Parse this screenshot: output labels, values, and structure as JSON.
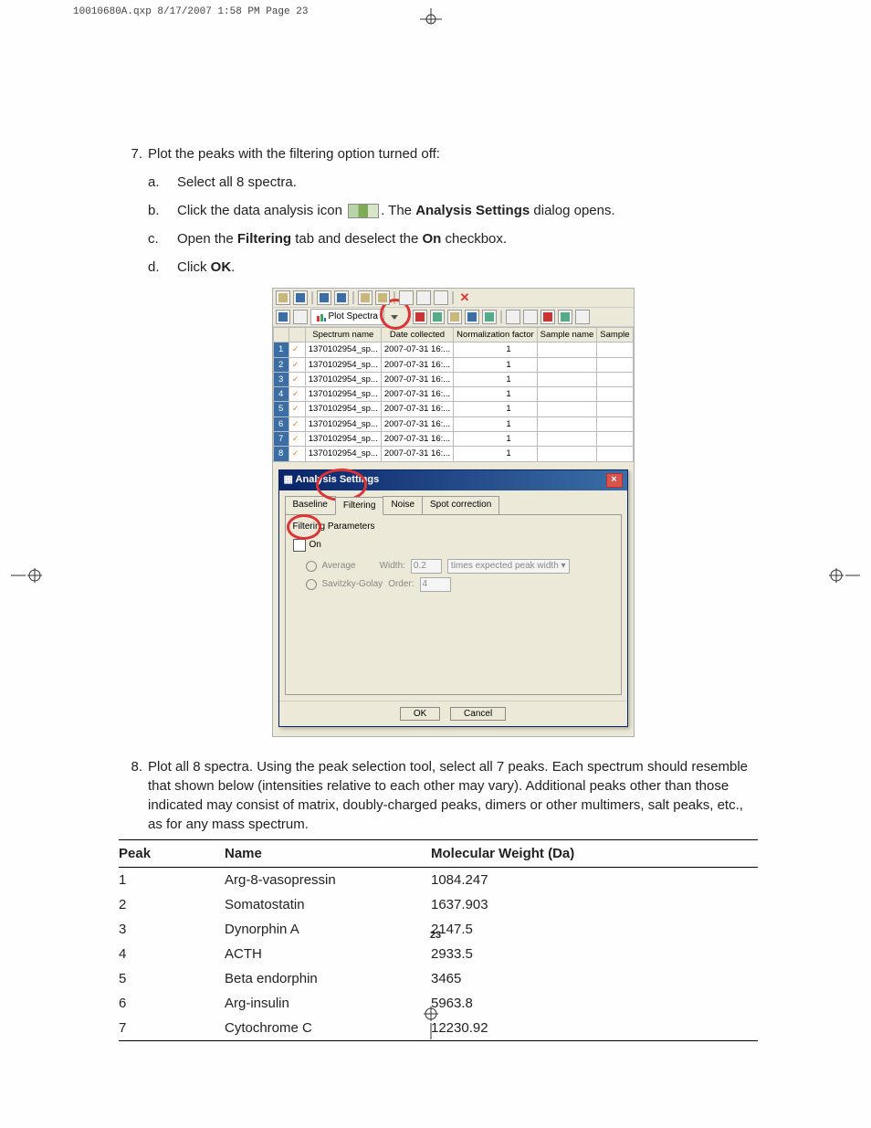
{
  "meta_header": "10010680A.qxp  8/17/2007  1:58 PM  Page 23",
  "page_number": "23",
  "step7": {
    "num": "7.",
    "intro": "Plot the peaks with the filtering option turned off:",
    "a": {
      "l": "a.",
      "t": "Select all 8 spectra."
    },
    "b": {
      "l": "b.",
      "pre": "Click the data analysis icon ",
      "post": ". The ",
      "bold": "Analysis Settings",
      "tail": " dialog opens."
    },
    "c": {
      "l": "c.",
      "pre": "Open the ",
      "b1": "Filtering",
      "mid": " tab and deselect the ",
      "b2": "On",
      "tail": " checkbox."
    },
    "d": {
      "l": "d.",
      "pre": "Click ",
      "b": "OK",
      "tail": "."
    }
  },
  "app": {
    "plot_label": "Plot Spectra",
    "columns": [
      "Spectrum name",
      "Date collected",
      "Normalization factor",
      "Sample name",
      "Sample"
    ],
    "rows": [
      {
        "n": "1",
        "name": "1370102954_sp...",
        "date": "2007-07-31 16:...",
        "nf": "1"
      },
      {
        "n": "2",
        "name": "1370102954_sp...",
        "date": "2007-07-31 16:...",
        "nf": "1"
      },
      {
        "n": "3",
        "name": "1370102954_sp...",
        "date": "2007-07-31 16:...",
        "nf": "1"
      },
      {
        "n": "4",
        "name": "1370102954_sp...",
        "date": "2007-07-31 16:...",
        "nf": "1"
      },
      {
        "n": "5",
        "name": "1370102954_sp...",
        "date": "2007-07-31 16:...",
        "nf": "1"
      },
      {
        "n": "6",
        "name": "1370102954_sp...",
        "date": "2007-07-31 16:...",
        "nf": "1"
      },
      {
        "n": "7",
        "name": "1370102954_sp...",
        "date": "2007-07-31 16:...",
        "nf": "1"
      },
      {
        "n": "8",
        "name": "1370102954_sp...",
        "date": "2007-07-31 16:...",
        "nf": "1"
      }
    ]
  },
  "dialog": {
    "title": "Analysis Settings",
    "tabs": [
      "Baseline",
      "Filtering",
      "Noise",
      "Spot correction"
    ],
    "param_title": "Filtering Parameters",
    "on_label": "On",
    "avg": "Average",
    "width_lbl": "Width:",
    "width_val": "0.2",
    "width_unit": "times expected peak width",
    "sg": "Savitzky-Golay",
    "order_lbl": "Order:",
    "order_val": "4",
    "ok": "OK",
    "cancel": "Cancel"
  },
  "step8": {
    "num": "8.",
    "text": "Plot all 8 spectra. Using the peak selection tool, select all 7 peaks. Each spectrum should resemble that shown below (intensities relative to each other may vary). Additional peaks other than those indicated may consist of matrix, doubly-charged peaks, dimers or other multimers, salt peaks, etc., as for any mass spectrum."
  },
  "peak_table": {
    "headers": [
      "Peak",
      "Name",
      "Molecular Weight (Da)"
    ],
    "rows": [
      {
        "p": "1",
        "n": "Arg-8-vasopressin",
        "mw": "1084.247"
      },
      {
        "p": "2",
        "n": "Somatostatin",
        "mw": "1637.903"
      },
      {
        "p": "3",
        "n": "Dynorphin A",
        "mw": "2147.5"
      },
      {
        "p": "4",
        "n": "ACTH",
        "mw": "2933.5"
      },
      {
        "p": "5",
        "n": "Beta endorphin",
        "mw": "3465"
      },
      {
        "p": "6",
        "n": "Arg-insulin",
        "mw": "5963.8"
      },
      {
        "p": "7",
        "n": "Cytochrome C",
        "mw": "12230.92"
      }
    ]
  }
}
